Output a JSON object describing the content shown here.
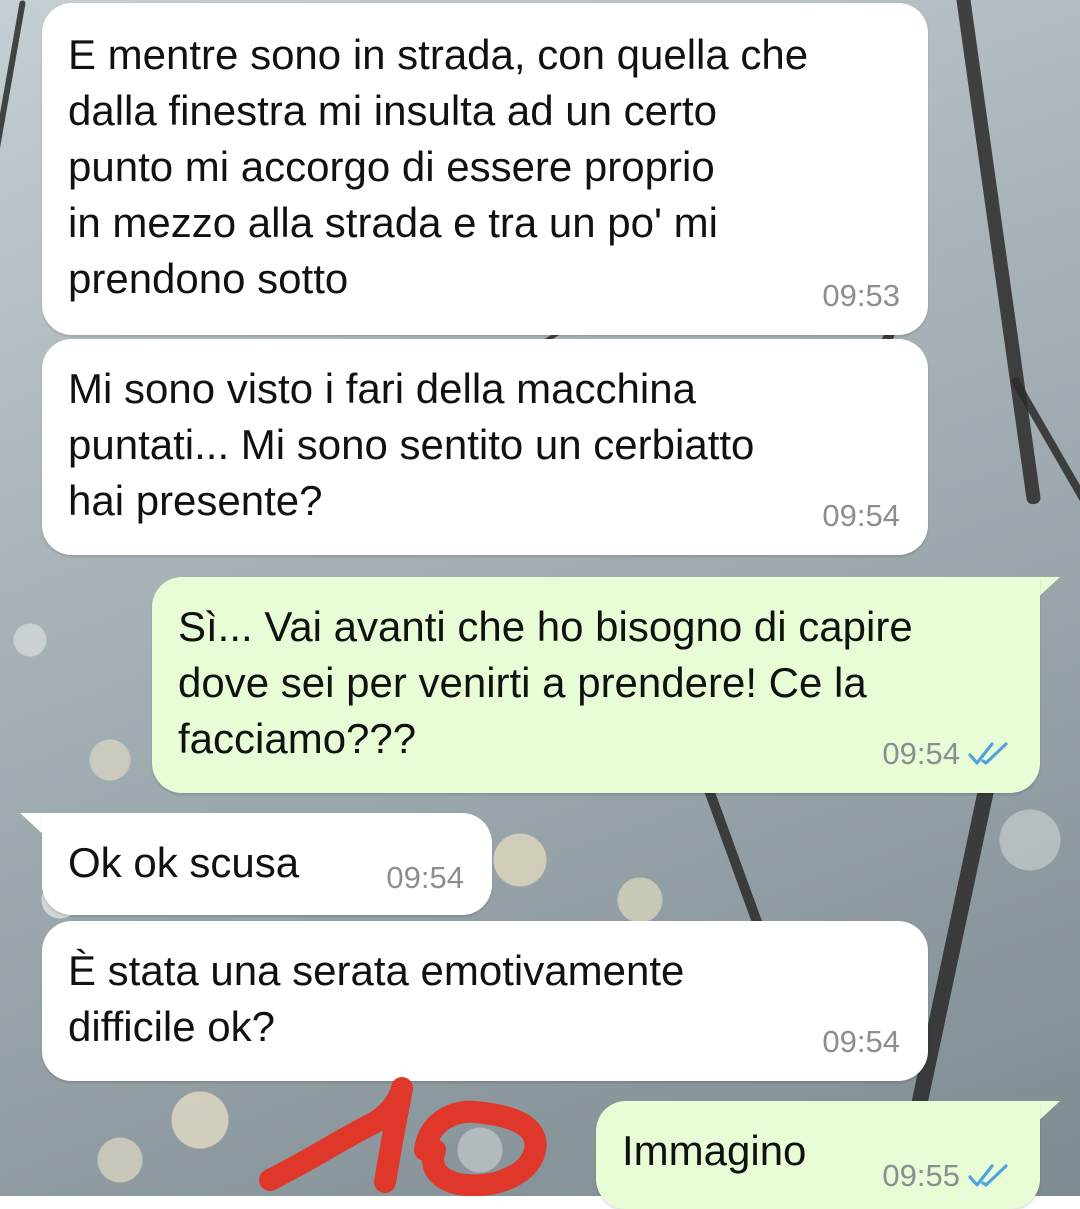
{
  "messages": [
    {
      "direction": "incoming",
      "text": "E mentre sono in strada, con quella che\ndalla finestra mi insulta ad un certo\npunto mi accorgo di essere proprio\nin mezzo alla strada e tra un po' mi\nprendono sotto",
      "time": "09:53"
    },
    {
      "direction": "incoming",
      "text": "Mi sono visto i fari della macchina\npuntati... Mi sono sentito un cerbiatto\nhai presente?",
      "time": "09:54"
    },
    {
      "direction": "outgoing",
      "text": "Sì... Vai avanti che ho bisogno di capire\ndove sei per venirti a prendere! Ce la\nfacciamo???",
      "time": "09:54",
      "status_icon": "double-check-read-icon"
    },
    {
      "direction": "incoming",
      "text": "Ok ok scusa",
      "time": "09:54"
    },
    {
      "direction": "incoming",
      "text": "È stata una serata emotivamente\ndifficile ok?",
      "time": "09:54"
    },
    {
      "direction": "outgoing",
      "text": "Immagino",
      "time": "09:55",
      "status_icon": "double-check-read-icon"
    }
  ],
  "annotation": {
    "text": "10",
    "color": "#e0372b"
  },
  "colors": {
    "incoming_bubble": "#ffffff",
    "outgoing_bubble": "#e8fcd6",
    "timestamp": "#8a8f92",
    "read_tick": "#4fa3e0"
  }
}
